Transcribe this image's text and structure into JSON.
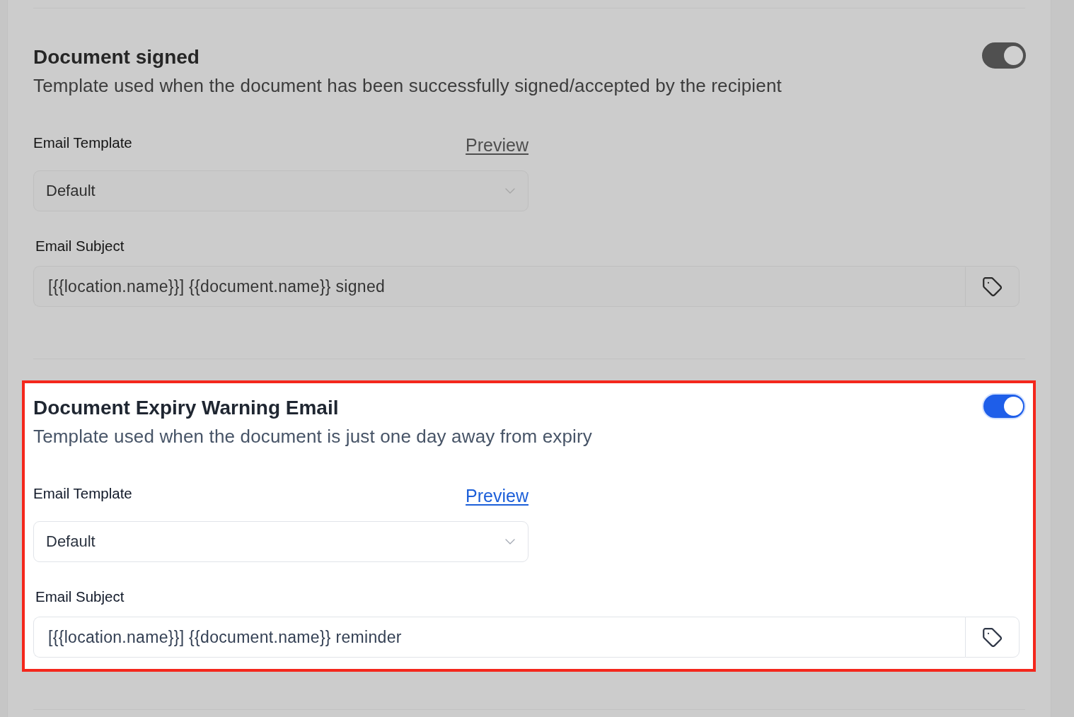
{
  "sections": [
    {
      "title": "Document signed",
      "description": "Template used when the document has been successfully signed/accepted by the recipient",
      "enabled": true,
      "highlighted": false,
      "email_template": {
        "label": "Email Template",
        "preview_link": "Preview",
        "value": "Default"
      },
      "email_subject": {
        "label": "Email Subject",
        "value": "[{{location.name}}] {{document.name}} signed"
      }
    },
    {
      "title": "Document Expiry Warning Email",
      "description": "Template used when the document is just one day away from expiry",
      "enabled": true,
      "highlighted": true,
      "email_template": {
        "label": "Email Template",
        "preview_link": "Preview",
        "value": "Default"
      },
      "email_subject": {
        "label": "Email Subject",
        "value": "[{{location.name}}] {{document.name}} reminder"
      }
    }
  ]
}
